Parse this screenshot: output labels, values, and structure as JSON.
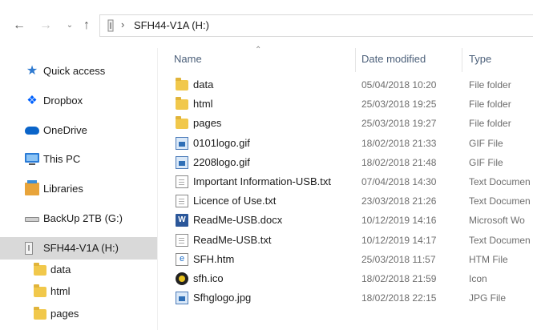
{
  "address": {
    "path": "SFH44-V1A (H:)"
  },
  "nav": {
    "back_icon": "arrow-left-icon",
    "forward_icon": "arrow-right-icon",
    "recent_icon": "chevron-down-icon",
    "up_icon": "arrow-up-icon"
  },
  "navpane": {
    "items": [
      {
        "label": "Quick access",
        "icon": "star-icon"
      },
      {
        "label": "Dropbox",
        "icon": "dropbox-icon"
      },
      {
        "label": "OneDrive",
        "icon": "cloud-icon"
      },
      {
        "label": "This PC",
        "icon": "computer-icon"
      },
      {
        "label": "Libraries",
        "icon": "library-icon"
      },
      {
        "label": "BackUp 2TB (G:)",
        "icon": "hard-drive-icon"
      },
      {
        "label": "SFH44-V1A (H:)",
        "icon": "usb-drive-icon",
        "selected": true
      },
      {
        "label": "data",
        "icon": "folder-icon"
      },
      {
        "label": "html",
        "icon": "folder-icon"
      },
      {
        "label": "pages",
        "icon": "folder-icon"
      }
    ]
  },
  "columns": {
    "name": "Name",
    "date": "Date modified",
    "type": "Type"
  },
  "files": [
    {
      "name": "data",
      "date": "05/04/2018 10:20",
      "type": "File folder",
      "icon": "folder-icon"
    },
    {
      "name": "html",
      "date": "25/03/2018 19:25",
      "type": "File folder",
      "icon": "folder-icon"
    },
    {
      "name": "pages",
      "date": "25/03/2018 19:27",
      "type": "File folder",
      "icon": "folder-icon"
    },
    {
      "name": "0101logo.gif",
      "date": "18/02/2018 21:33",
      "type": "GIF File",
      "icon": "image-file-icon"
    },
    {
      "name": "2208logo.gif",
      "date": "18/02/2018 21:48",
      "type": "GIF File",
      "icon": "image-file-icon"
    },
    {
      "name": "Important Information-USB.txt",
      "date": "07/04/2018 14:30",
      "type": "Text Documen",
      "icon": "text-file-icon"
    },
    {
      "name": "Licence of Use.txt",
      "date": "23/03/2018 21:26",
      "type": "Text Documen",
      "icon": "text-file-icon"
    },
    {
      "name": "ReadMe-USB.docx",
      "date": "10/12/2019 14:16",
      "type": "Microsoft Wo",
      "icon": "word-file-icon"
    },
    {
      "name": "ReadMe-USB.txt",
      "date": "10/12/2019 14:17",
      "type": "Text Documen",
      "icon": "text-file-icon"
    },
    {
      "name": "SFH.htm",
      "date": "25/03/2018 11:57",
      "type": "HTM File",
      "icon": "html-file-icon"
    },
    {
      "name": "sfh.ico",
      "date": "18/02/2018 21:59",
      "type": "Icon",
      "icon": "ico-file-icon"
    },
    {
      "name": "Sfhglogo.jpg",
      "date": "18/02/2018 22:15",
      "type": "JPG File",
      "icon": "image-file-icon"
    }
  ]
}
